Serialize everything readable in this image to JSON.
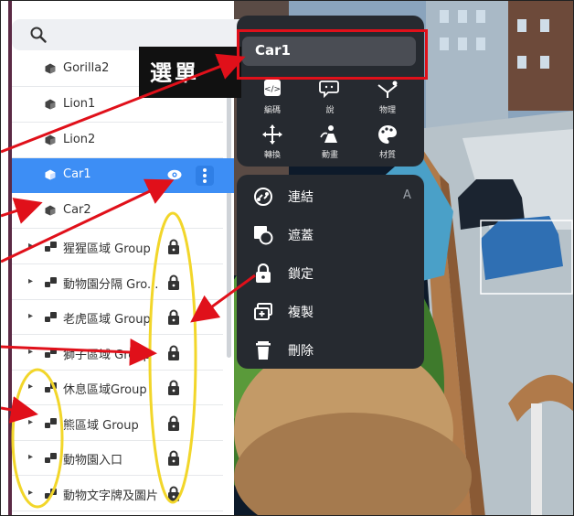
{
  "search": {
    "icon": "search-icon"
  },
  "object_list": {
    "rows": [
      {
        "label": "Gorilla2",
        "type": "object",
        "expandable": false,
        "locked": false,
        "selected": false
      },
      {
        "label": "Lion1",
        "type": "object",
        "expandable": false,
        "locked": false,
        "selected": false
      },
      {
        "label": "Lion2",
        "type": "object",
        "expandable": false,
        "locked": false,
        "selected": false
      },
      {
        "label": "Car1",
        "type": "object",
        "expandable": false,
        "locked": false,
        "selected": true
      },
      {
        "label": "Car2",
        "type": "object",
        "expandable": false,
        "locked": false,
        "selected": false
      },
      {
        "label": "猩猩區域 Group",
        "type": "group",
        "expandable": true,
        "locked": true,
        "selected": false
      },
      {
        "label": "動物園分隔 Gro...",
        "type": "group",
        "expandable": true,
        "locked": true,
        "selected": false
      },
      {
        "label": "老虎區域 Group",
        "type": "group",
        "expandable": true,
        "locked": true,
        "selected": false
      },
      {
        "label": "獅子區域 Group",
        "type": "group",
        "expandable": true,
        "locked": true,
        "selected": false
      },
      {
        "label": "休息區域Group",
        "type": "group",
        "expandable": true,
        "locked": true,
        "selected": false
      },
      {
        "label": "熊區域 Group",
        "type": "group",
        "expandable": true,
        "locked": true,
        "selected": false
      },
      {
        "label": "動物園入口",
        "type": "group",
        "expandable": true,
        "locked": true,
        "selected": false
      },
      {
        "label": "動物文字牌及圖片",
        "type": "group",
        "expandable": true,
        "locked": true,
        "selected": false
      }
    ]
  },
  "context_menu": {
    "title_value": "Car1",
    "tools": [
      {
        "label": "編碼",
        "icon": "code-icon"
      },
      {
        "label": "說",
        "icon": "speech-icon"
      },
      {
        "label": "物理",
        "icon": "physics-icon"
      },
      {
        "label": "轉換",
        "icon": "move-icon"
      },
      {
        "label": "動畫",
        "icon": "animation-icon"
      },
      {
        "label": "材質",
        "icon": "palette-icon"
      }
    ],
    "items": [
      {
        "label": "連結",
        "icon": "link-icon",
        "shortcut": "A"
      },
      {
        "label": "遮蓋",
        "icon": "mask-icon",
        "shortcut": ""
      },
      {
        "label": "鎖定",
        "icon": "lock-icon",
        "shortcut": ""
      },
      {
        "label": "複製",
        "icon": "duplicate-icon",
        "shortcut": ""
      },
      {
        "label": "刪除",
        "icon": "trash-icon",
        "shortcut": ""
      }
    ]
  },
  "annotation": {
    "callout_text": "選單"
  },
  "colors": {
    "selection": "#3d8ef5",
    "menu_bg": "#262a30",
    "annotation_red": "#e0101a",
    "annotation_yellow": "#f2d62a"
  }
}
